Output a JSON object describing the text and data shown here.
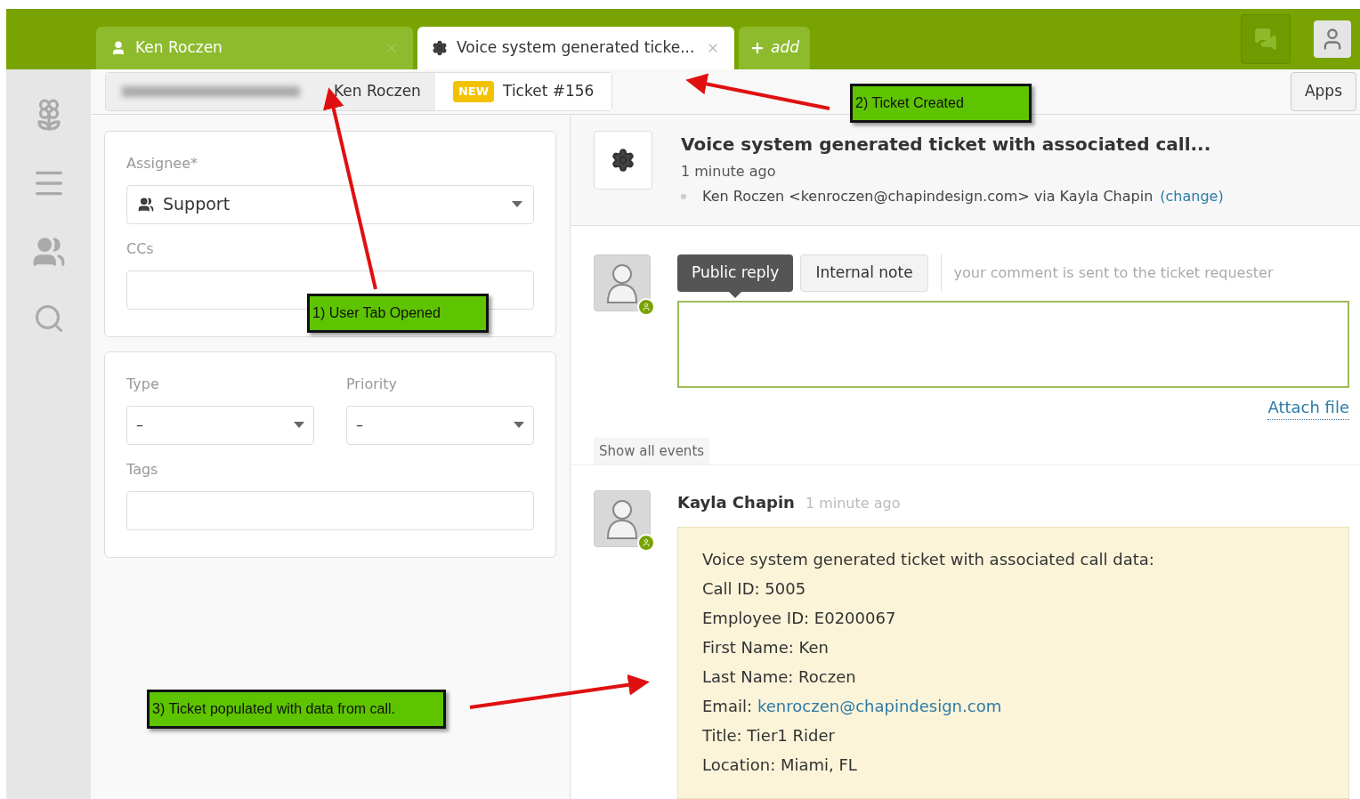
{
  "tabs": [
    {
      "kind": "user",
      "label": "Ken Roczen",
      "selected": false
    },
    {
      "kind": "ticket",
      "label": "Voice system generated ticke...",
      "selected": true
    }
  ],
  "add_tab": "add",
  "breadcrumb": {
    "requester": "Ken Roczen",
    "badge": "NEW",
    "ticket": "Ticket #156"
  },
  "apps_button": "Apps",
  "form": {
    "assignee_label": "Assignee*",
    "assignee": "Support",
    "ccs_label": "CCs",
    "type_label": "Type",
    "type": "–",
    "priority_label": "Priority",
    "priority": "–",
    "tags_label": "Tags"
  },
  "ticket": {
    "title": "Voice system generated ticket with associated call...",
    "time": "1 minute ago",
    "requester": "Ken Roczen <kenroczen@chapindesign.com> via Kayla Chapin",
    "change": "(change)"
  },
  "reply": {
    "modes": [
      {
        "label": "Public reply",
        "selected": true
      },
      {
        "label": "Internal note",
        "selected": false
      }
    ],
    "hint": "your comment is sent to the ticket requester",
    "attach": "Attach file"
  },
  "show_all": "Show all events",
  "comment": {
    "author": "Kayla Chapin",
    "time": "1 minute ago",
    "lines": [
      {
        "kind": "text",
        "text": "Voice system generated ticket with associated call data:"
      },
      {
        "kind": "text",
        "text": "Call ID: 5005"
      },
      {
        "kind": "text",
        "text": "Employee ID: E0200067"
      },
      {
        "kind": "text",
        "text": "First Name: Ken"
      },
      {
        "kind": "text",
        "text": "Last Name: Roczen"
      },
      {
        "kind": "link",
        "text": "Email:",
        "link": "kenroczen@chapindesign.com"
      },
      {
        "kind": "text",
        "text": "Title: Tier1 Rider"
      },
      {
        "kind": "text",
        "text": "Location: Miami, FL"
      }
    ]
  },
  "annotations": [
    {
      "label": "1) User Tab Opened"
    },
    {
      "label": "2) Ticket Created"
    },
    {
      "label": "3) Ticket populated with data from call."
    }
  ]
}
